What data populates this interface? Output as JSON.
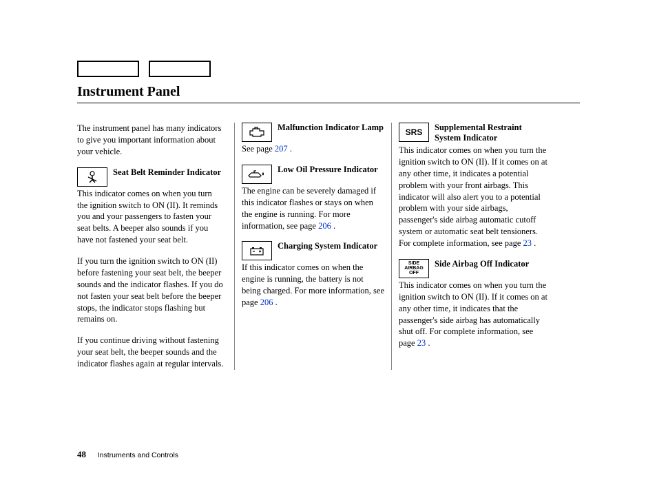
{
  "page_title": "Instrument Panel",
  "intro": "The instrument panel has many indicators to give you important information about your vehicle.",
  "col1": {
    "seatbelt": {
      "title": "Seat Belt Reminder Indicator",
      "icon": "seatbelt-icon",
      "body1": "This indicator comes on when you turn the ignition switch to ON (II). It reminds you and your passengers to fasten your seat belts. A beeper also sounds if you have not fastened your seat belt.",
      "body2": "If you turn the ignition switch to ON (II) before fastening your seat belt, the beeper sounds and the indicator flashes. If you do not fasten your seat belt before the beeper stops, the indicator stops flashing but remains on.",
      "body3": "If you continue driving without fastening your seat belt, the beeper sounds and the indicator flashes again at regular intervals."
    }
  },
  "col2": {
    "malfunction": {
      "title": "Malfunction Indicator Lamp",
      "icon": "engine-icon",
      "see_prefix": "See page ",
      "page": "207",
      "see_suffix": " ."
    },
    "lowoil": {
      "title": "Low Oil Pressure Indicator",
      "icon": "oil-icon",
      "body_prefix": "The engine can be severely damaged if this indicator flashes or stays on when the engine is running. For more information, see page ",
      "page": "206",
      "body_suffix": " ."
    },
    "charging": {
      "title": "Charging System Indicator",
      "icon": "battery-icon",
      "body_prefix": "If this indicator comes on when the engine is running, the battery is not being charged. For more information, see page ",
      "page": "206",
      "body_suffix": " ."
    }
  },
  "col3": {
    "srs": {
      "icon_text": "SRS",
      "title": "Supplemental Restraint System Indicator",
      "body_prefix": "This indicator comes on when you turn the ignition switch to ON (II). If it comes on at any other time, it indicates a potential problem with your front airbags. This indicator will also alert you to a potential problem with your side airbags, passenger's side airbag automatic cutoff system or automatic seat belt tensioners. For complete information, see page ",
      "page": "23",
      "body_suffix": " ."
    },
    "sideairbag": {
      "icon_text": "SIDE\nAIRBAG\nOFF",
      "title": "Side Airbag Off Indicator",
      "body_prefix": "This indicator comes on when you turn the ignition switch to ON (II). If it comes on at any other time, it indicates that the passenger's side airbag has automatically shut off. For complete information, see page ",
      "page": "23",
      "body_suffix": " ."
    }
  },
  "footer": {
    "page_num": "48",
    "section": "Instruments and Controls"
  }
}
